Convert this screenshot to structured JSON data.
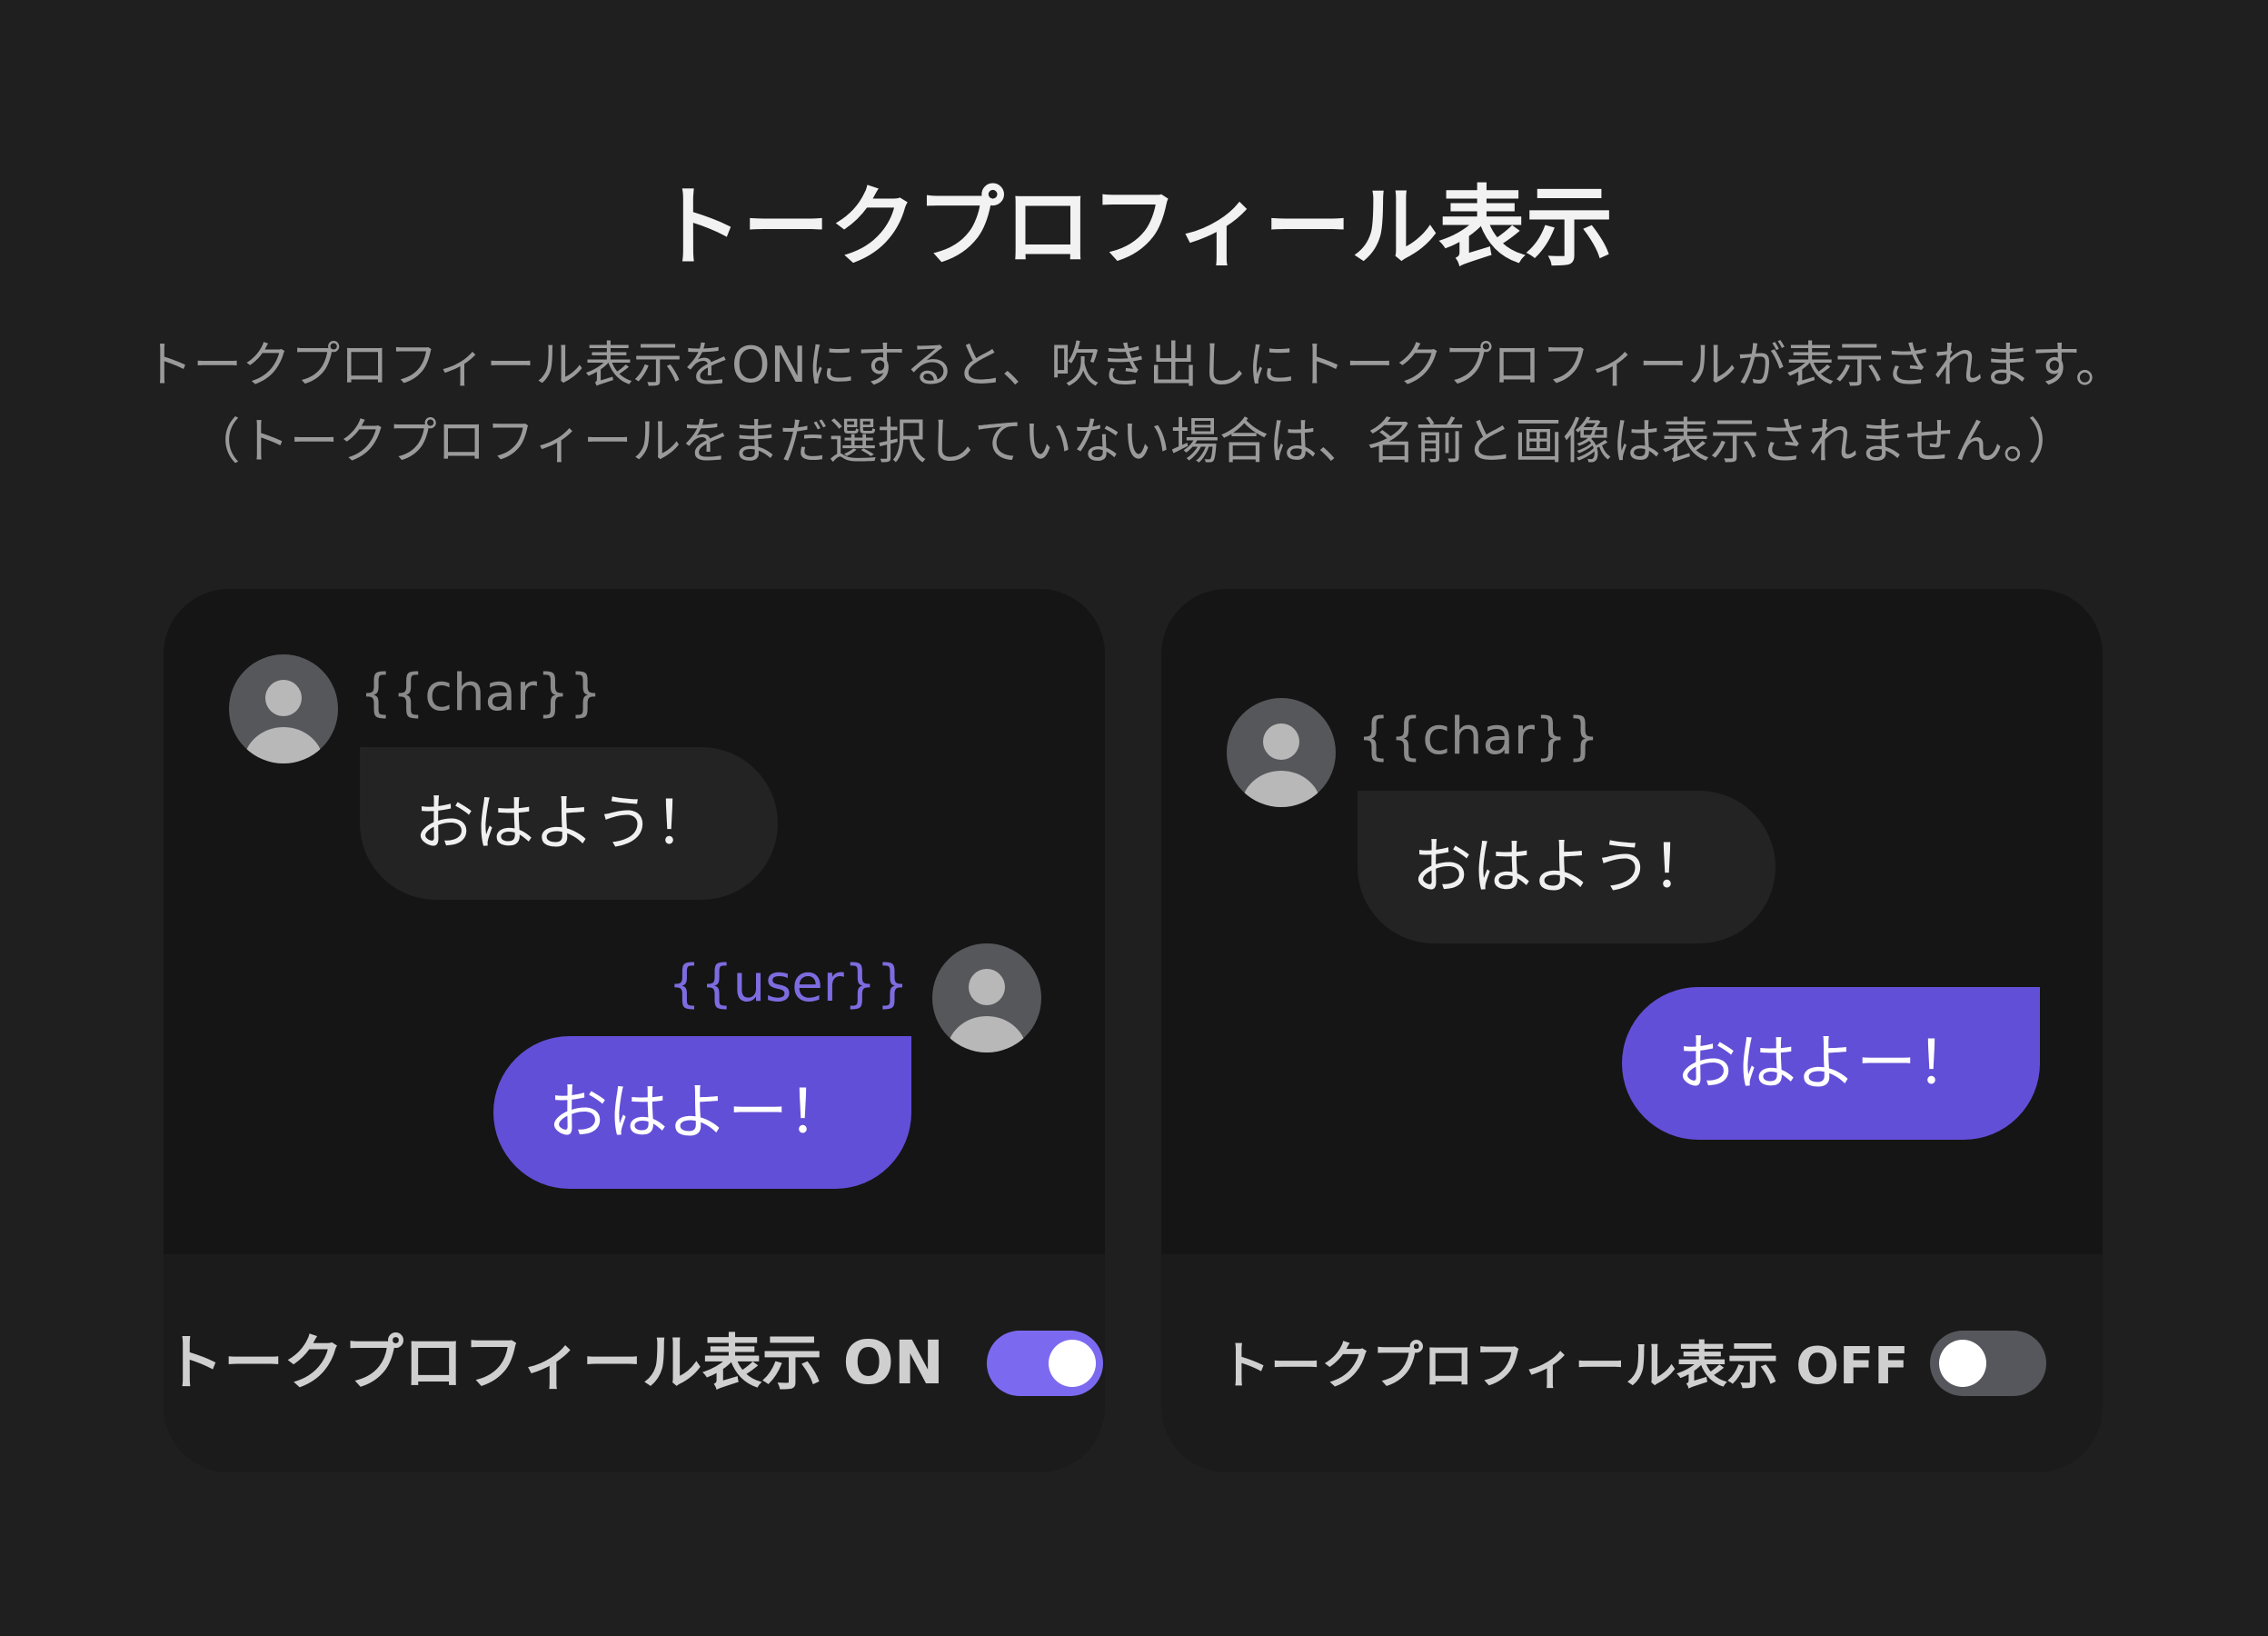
{
  "header": {
    "title": "トークプロフィール表示",
    "description_line1": "トークプロフィール表示をONにすると、吹き出しにトークプロフィールが表示されます。",
    "description_line2": "（トークプロフィールをまだ選択していない場合は、名前と画像は表示されません。）"
  },
  "card_on": {
    "char_name": "{{char}}",
    "char_message": "おはよう！",
    "user_name": "{{user}}",
    "user_message": "おはよー！",
    "toggle_label": "トークプロフィール表示 ON",
    "toggle_state": true
  },
  "card_off": {
    "char_name": "{{char}}",
    "char_message": "おはよう！",
    "user_message": "おはよー！",
    "toggle_label": "トークプロフィール表示 OFF",
    "toggle_state": false
  },
  "colors": {
    "background": "#1f1f1f",
    "card": "#1b1b1b",
    "preview": "#151515",
    "user_bubble": "#624fd7",
    "char_bubble": "#232323",
    "user_name": "#7d6ce0",
    "switch_on": "#7b6af0",
    "switch_off": "#55575c"
  },
  "icons": {
    "avatar": "person-avatar-icon"
  }
}
